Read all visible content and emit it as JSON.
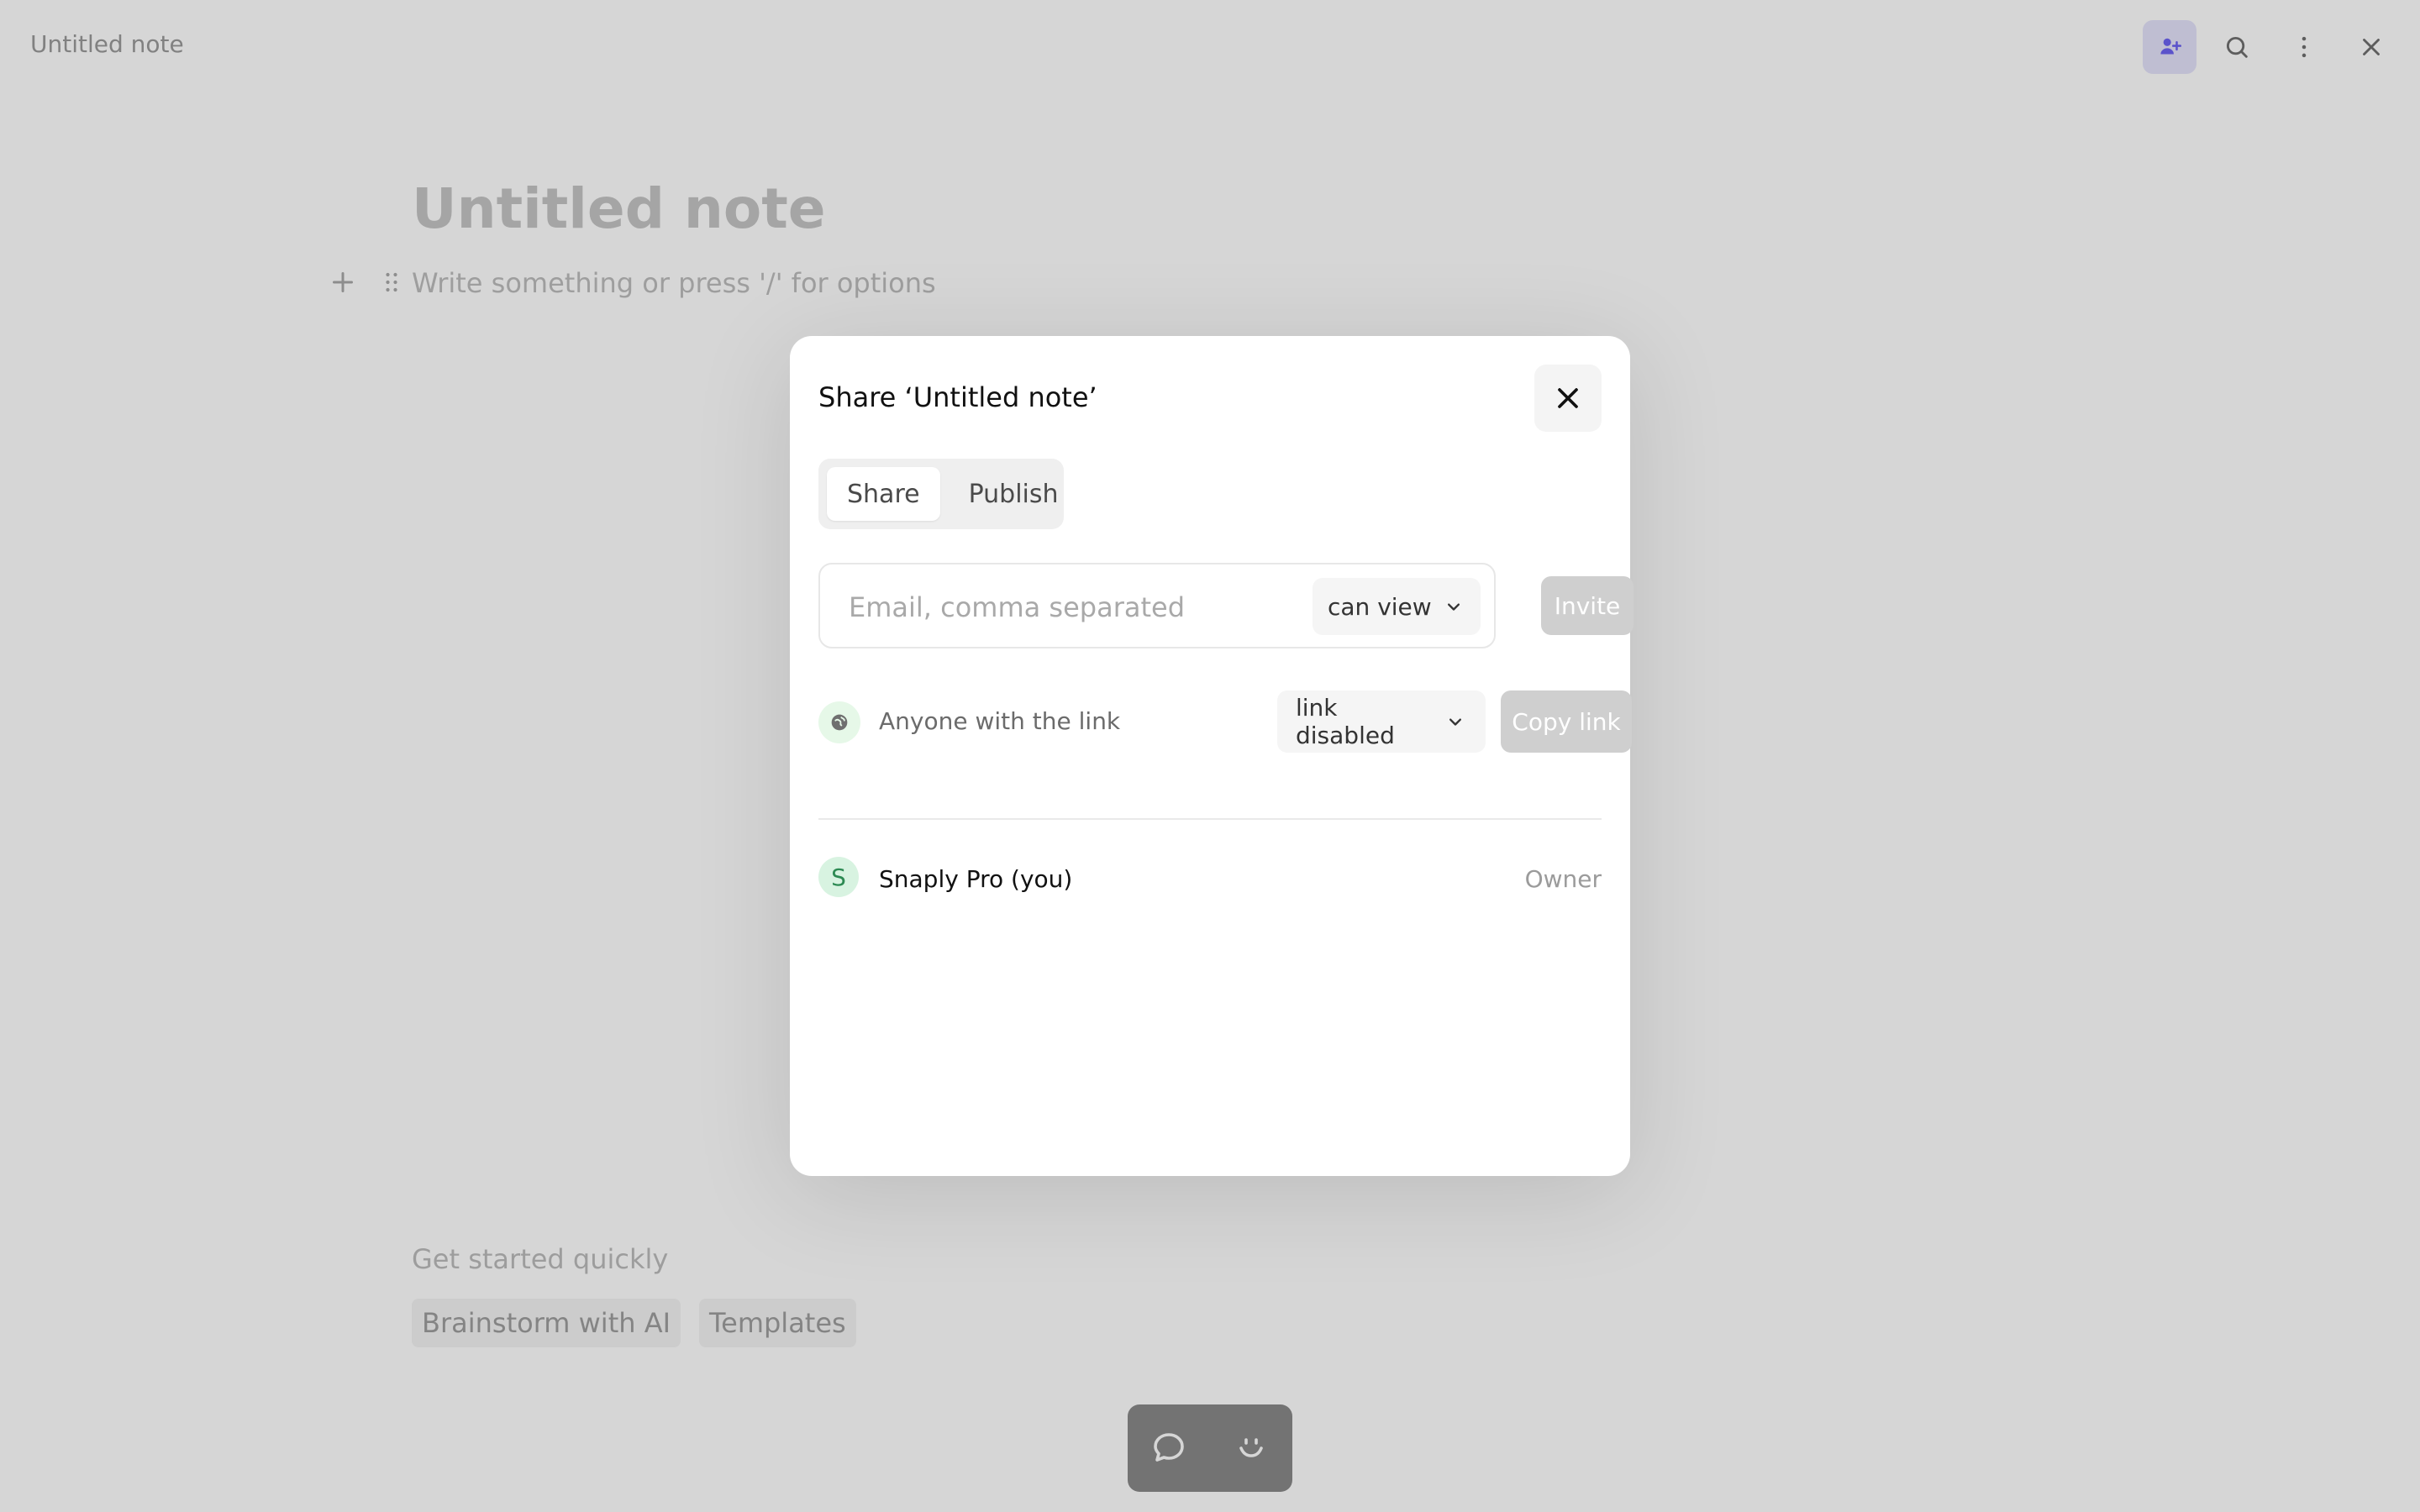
{
  "topbar": {
    "note_title": "Untitled note",
    "icons": [
      "share-users-icon",
      "search-icon",
      "more-vertical-icon",
      "close-icon"
    ],
    "active_color": "#6d63f2"
  },
  "editor": {
    "title": "Untitled note",
    "placeholder": "Write something or press '/' for options"
  },
  "quick_start": {
    "title": "Get started quickly",
    "chips": [
      "Brainstorm with AI",
      "Templates"
    ]
  },
  "bottom_bar": {
    "icons": [
      "chat-icon",
      "smile-icon"
    ]
  },
  "modal": {
    "title": "Share ‘Untitled note’",
    "tabs": [
      {
        "label": "Share",
        "active": true
      },
      {
        "label": "Publish",
        "active": false
      }
    ],
    "invite": {
      "placeholder": "Email, comma separated",
      "permission": "can view",
      "button": "Invite"
    },
    "link": {
      "label": "Anyone with the link",
      "status": "link disabled",
      "button": "Copy link"
    },
    "member": {
      "initial": "S",
      "name": "Snaply Pro (you)",
      "role": "Owner"
    }
  }
}
